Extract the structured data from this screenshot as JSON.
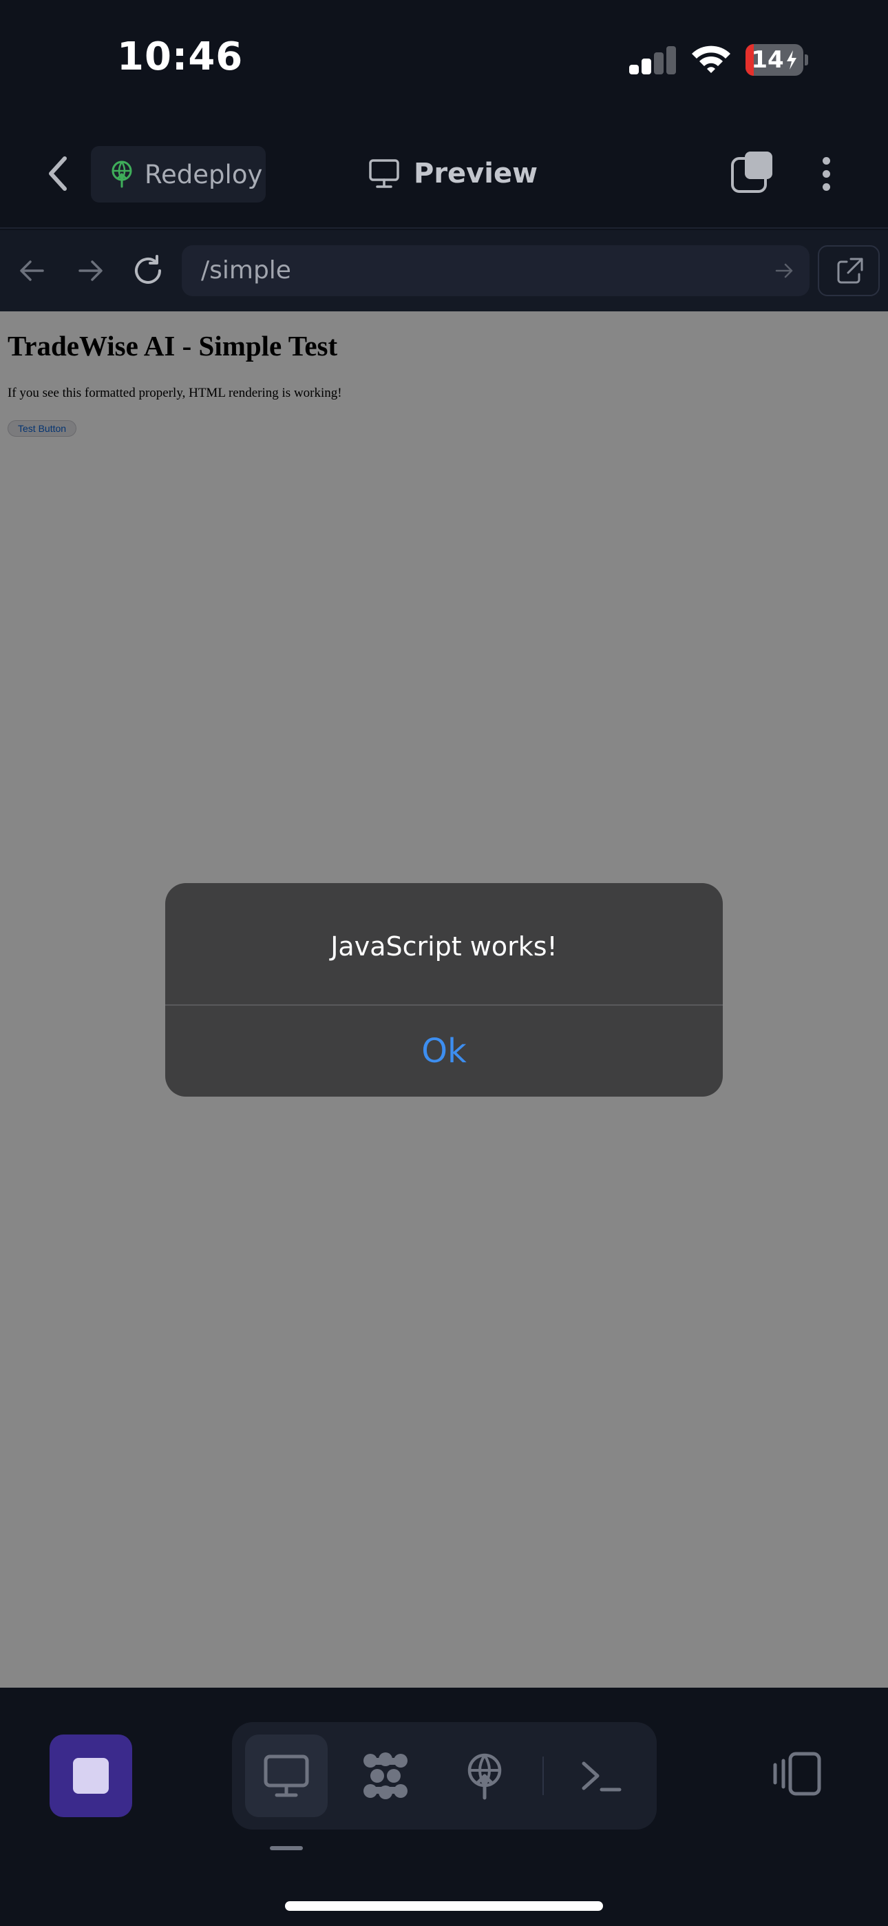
{
  "status_bar": {
    "time": "10:46",
    "battery_level": "14",
    "battery_fraction": 0.14,
    "battery_color": "#e5302c",
    "signal_bars_filled": 2,
    "signal_bars_total": 4,
    "wifi_icon": "wifi-icon"
  },
  "header": {
    "back_icon": "chevron-left-icon",
    "redeploy_label": "Redeploy",
    "redeploy_icon": "globe-upload-icon",
    "redeploy_icon_color": "#3fae5a",
    "title": "Preview",
    "title_icon": "monitor-icon",
    "tabs_icon": "tabs-icon",
    "more_icon": "more-vertical-icon"
  },
  "url_bar": {
    "back_icon": "arrow-left-icon",
    "forward_icon": "arrow-right-icon",
    "reload_icon": "reload-icon",
    "url": "/simple",
    "go_icon": "arrow-right-icon",
    "open_external_icon": "external-link-icon"
  },
  "web_page": {
    "heading": "TradeWise AI - Simple Test",
    "paragraph": "If you see this formatted properly, HTML rendering is working!",
    "button_label": "Test Button"
  },
  "alert": {
    "message": "JavaScript works!",
    "ok_label": "Ok",
    "ok_color": "#3d8ef0"
  },
  "bottom_bar": {
    "stop_icon": "stop-icon",
    "stop_color": "#3b2a8c",
    "tools": [
      {
        "icon": "monitor-icon",
        "active": true
      },
      {
        "icon": "agent-icon",
        "active": false
      },
      {
        "icon": "deploy-icon",
        "active": false
      },
      {
        "icon": "terminal-icon",
        "active": false
      }
    ],
    "device_icon": "device-switch-icon"
  }
}
